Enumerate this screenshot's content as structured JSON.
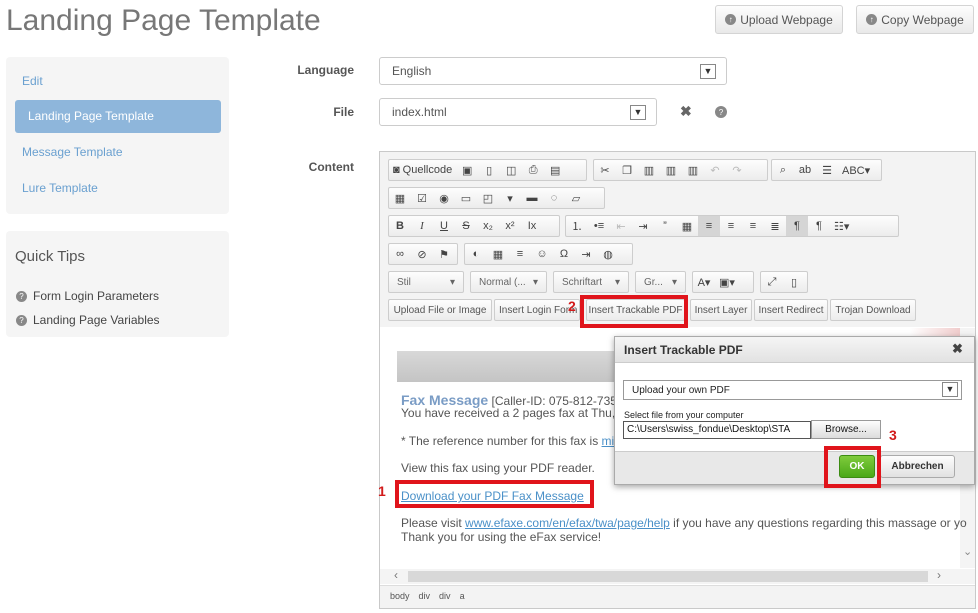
{
  "page_title": "Landing Page Template",
  "header_buttons": {
    "upload": "Upload Webpage",
    "copy": "Copy Webpage"
  },
  "sidebar": {
    "items": [
      {
        "label": "Edit"
      },
      {
        "label": "Landing Page Template"
      },
      {
        "label": "Message Template"
      },
      {
        "label": "Lure Template"
      }
    ]
  },
  "quick_tips": {
    "title": "Quick Tips",
    "items": [
      {
        "label": "Form Login Parameters"
      },
      {
        "label": "Landing Page Variables"
      }
    ]
  },
  "form": {
    "language_label": "Language",
    "language_value": "English",
    "file_label": "File",
    "file_value": "index.html",
    "content_label": "Content"
  },
  "toolbar": {
    "source_label": "Quellcode",
    "style_combo": "Stil",
    "format_combo": "Normal (...",
    "font_combo": "Schriftart",
    "size_combo": "Gr...",
    "custom_buttons": [
      "Upload File or Image",
      "Insert Login Form",
      "Insert Trackable PDF",
      "Insert Layer",
      "Insert Redirect",
      "Trojan Download"
    ]
  },
  "content": {
    "fax_heading": "Fax Message",
    "caller_id": "[Caller-ID: 075-812-735",
    "line_received": "You have received a 2 pages fax at Thu,",
    "line_reference_prefix": "* The reference number for this fax is ",
    "line_reference_link": "mi",
    "line_view": "View this fax using your PDF reader.",
    "download_link": "Download your PDF Fax Message",
    "line_visit_prefix": "Please visit ",
    "visit_link": "www.efaxe.com/en/efax/twa/page/help",
    "line_visit_suffix": " if you have any questions regarding this massage or yo",
    "line_thanks": "Thank you for using the eFax service!"
  },
  "statusbar": [
    "body",
    "div",
    "div",
    "a"
  ],
  "dialog": {
    "title": "Insert Trackable PDF",
    "select_value": "Upload your own PDF",
    "file_label": "Select file from your computer",
    "file_path": "C:\\Users\\swiss_fondue\\Desktop\\STA",
    "browse_label": "Browse...",
    "ok_label": "OK",
    "cancel_label": "Abbrechen"
  },
  "annotations": {
    "step1": "1",
    "step2": "2",
    "step3": "3"
  },
  "colors": {
    "annotation_red": "#e0141b",
    "active_nav": "#8eb6db",
    "ok_green": "#5bb624",
    "link": "#4a90c8"
  }
}
